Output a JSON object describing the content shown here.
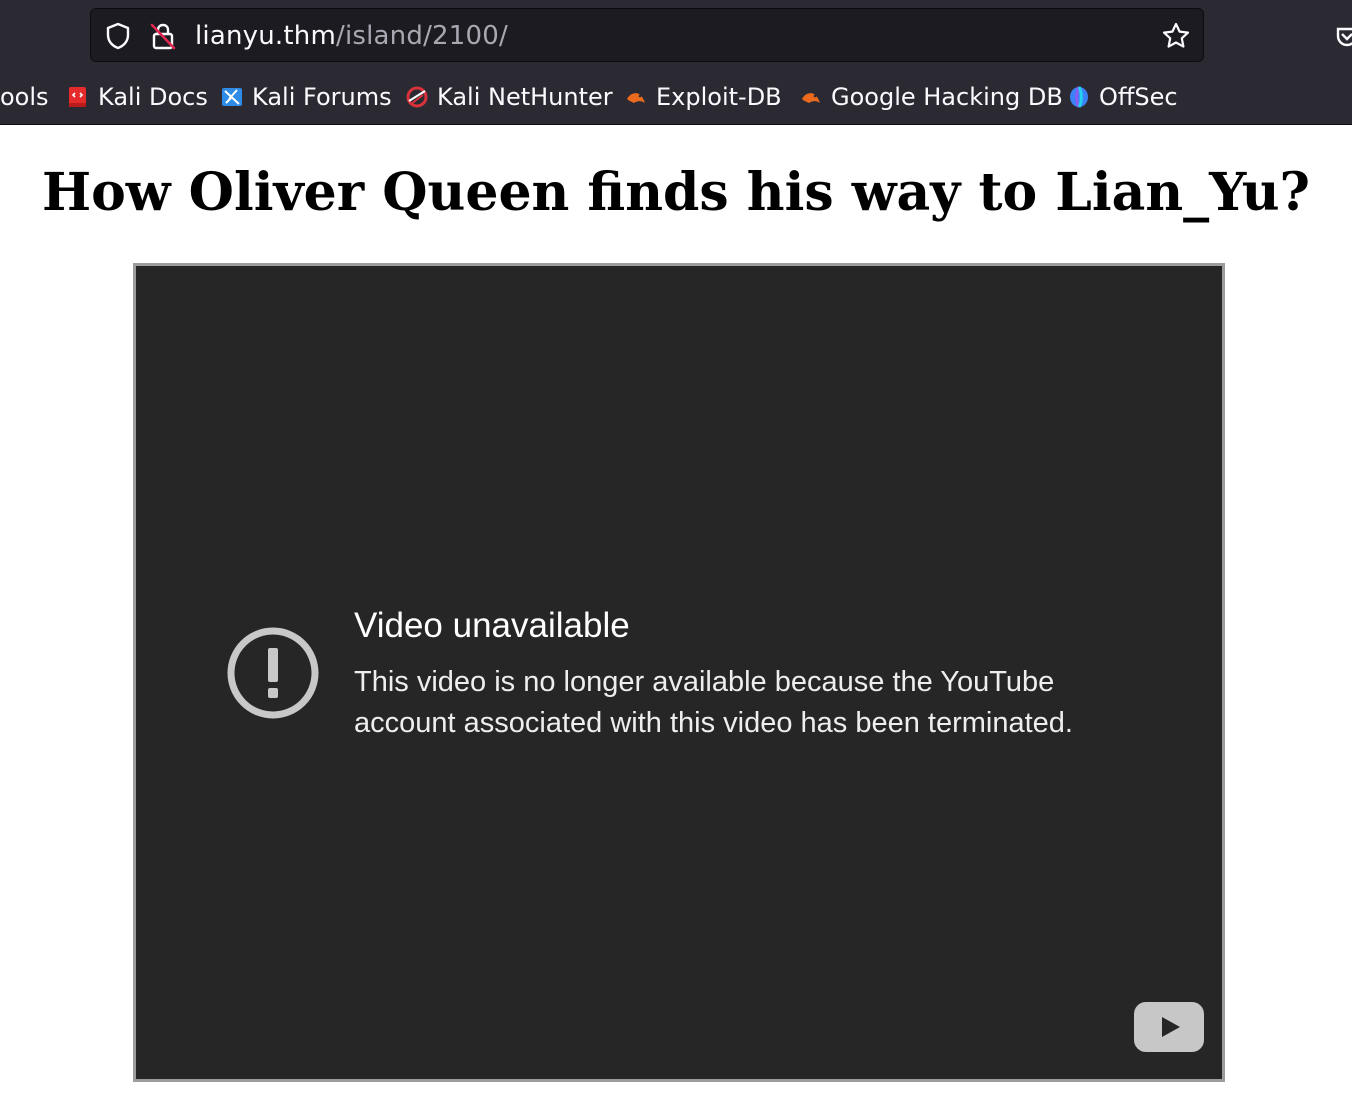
{
  "browser": {
    "url_host": "lianyu.thm",
    "url_path": "/island/2100/"
  },
  "bookmarks": [
    {
      "label": "ools",
      "icon": "kali-tools-icon",
      "color": "#2777ff"
    },
    {
      "label": "Kali Docs",
      "icon": "kali-docs-icon",
      "color": "#e52b2b"
    },
    {
      "label": "Kali Forums",
      "icon": "kali-forums-icon",
      "color": "#2f8ce6"
    },
    {
      "label": "Kali NetHunter",
      "icon": "kali-nethunter-icon",
      "color": "#d8323a"
    },
    {
      "label": "Exploit-DB",
      "icon": "exploit-db-icon",
      "color": "#ec6a1d"
    },
    {
      "label": "Google Hacking DB",
      "icon": "ghdb-icon",
      "color": "#ec6a1d"
    },
    {
      "label": "OffSec",
      "icon": "offsec-icon",
      "color": "#3b82f6"
    }
  ],
  "page": {
    "heading": "How Oliver Queen finds his way to Lian_Yu?"
  },
  "video": {
    "title": "Video unavailable",
    "message": "This video is no longer available because the YouTube account associated with this video has been terminated."
  }
}
